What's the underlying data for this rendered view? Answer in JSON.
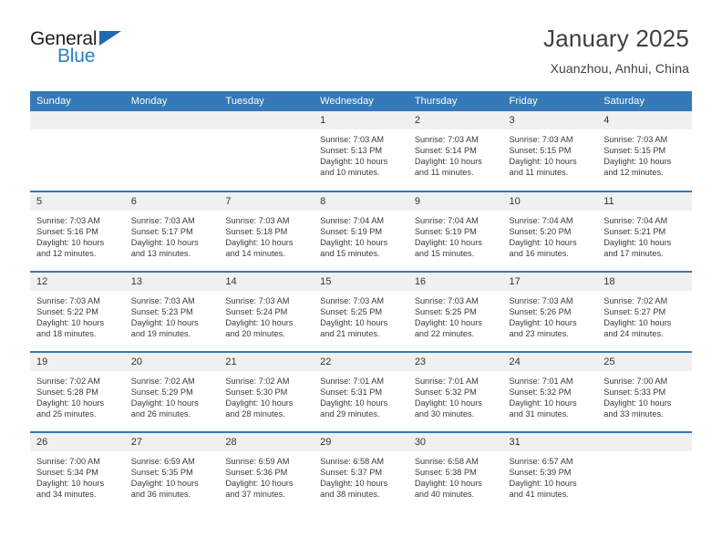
{
  "brand": {
    "name_top": "General",
    "name_bottom": "Blue",
    "triangle_color": "#1f6bb0",
    "blue_color": "#2a7fc1"
  },
  "header": {
    "title": "January 2025",
    "subtitle": "Xuanzhou, Anhui, China"
  },
  "theme": {
    "header_bg": "#3579b8",
    "daynum_bg": "#f0f0f0",
    "text_color": "#3a3a3a"
  },
  "weekdays": [
    "Sunday",
    "Monday",
    "Tuesday",
    "Wednesday",
    "Thursday",
    "Friday",
    "Saturday"
  ],
  "weeks": [
    [
      {
        "day": "",
        "empty": true
      },
      {
        "day": "",
        "empty": true
      },
      {
        "day": "",
        "empty": true
      },
      {
        "day": "1",
        "sunrise": "Sunrise: 7:03 AM",
        "sunset": "Sunset: 5:13 PM",
        "daylight1": "Daylight: 10 hours",
        "daylight2": "and 10 minutes."
      },
      {
        "day": "2",
        "sunrise": "Sunrise: 7:03 AM",
        "sunset": "Sunset: 5:14 PM",
        "daylight1": "Daylight: 10 hours",
        "daylight2": "and 11 minutes."
      },
      {
        "day": "3",
        "sunrise": "Sunrise: 7:03 AM",
        "sunset": "Sunset: 5:15 PM",
        "daylight1": "Daylight: 10 hours",
        "daylight2": "and 11 minutes."
      },
      {
        "day": "4",
        "sunrise": "Sunrise: 7:03 AM",
        "sunset": "Sunset: 5:15 PM",
        "daylight1": "Daylight: 10 hours",
        "daylight2": "and 12 minutes."
      }
    ],
    [
      {
        "day": "5",
        "sunrise": "Sunrise: 7:03 AM",
        "sunset": "Sunset: 5:16 PM",
        "daylight1": "Daylight: 10 hours",
        "daylight2": "and 12 minutes."
      },
      {
        "day": "6",
        "sunrise": "Sunrise: 7:03 AM",
        "sunset": "Sunset: 5:17 PM",
        "daylight1": "Daylight: 10 hours",
        "daylight2": "and 13 minutes."
      },
      {
        "day": "7",
        "sunrise": "Sunrise: 7:03 AM",
        "sunset": "Sunset: 5:18 PM",
        "daylight1": "Daylight: 10 hours",
        "daylight2": "and 14 minutes."
      },
      {
        "day": "8",
        "sunrise": "Sunrise: 7:04 AM",
        "sunset": "Sunset: 5:19 PM",
        "daylight1": "Daylight: 10 hours",
        "daylight2": "and 15 minutes."
      },
      {
        "day": "9",
        "sunrise": "Sunrise: 7:04 AM",
        "sunset": "Sunset: 5:19 PM",
        "daylight1": "Daylight: 10 hours",
        "daylight2": "and 15 minutes."
      },
      {
        "day": "10",
        "sunrise": "Sunrise: 7:04 AM",
        "sunset": "Sunset: 5:20 PM",
        "daylight1": "Daylight: 10 hours",
        "daylight2": "and 16 minutes."
      },
      {
        "day": "11",
        "sunrise": "Sunrise: 7:04 AM",
        "sunset": "Sunset: 5:21 PM",
        "daylight1": "Daylight: 10 hours",
        "daylight2": "and 17 minutes."
      }
    ],
    [
      {
        "day": "12",
        "sunrise": "Sunrise: 7:03 AM",
        "sunset": "Sunset: 5:22 PM",
        "daylight1": "Daylight: 10 hours",
        "daylight2": "and 18 minutes."
      },
      {
        "day": "13",
        "sunrise": "Sunrise: 7:03 AM",
        "sunset": "Sunset: 5:23 PM",
        "daylight1": "Daylight: 10 hours",
        "daylight2": "and 19 minutes."
      },
      {
        "day": "14",
        "sunrise": "Sunrise: 7:03 AM",
        "sunset": "Sunset: 5:24 PM",
        "daylight1": "Daylight: 10 hours",
        "daylight2": "and 20 minutes."
      },
      {
        "day": "15",
        "sunrise": "Sunrise: 7:03 AM",
        "sunset": "Sunset: 5:25 PM",
        "daylight1": "Daylight: 10 hours",
        "daylight2": "and 21 minutes."
      },
      {
        "day": "16",
        "sunrise": "Sunrise: 7:03 AM",
        "sunset": "Sunset: 5:25 PM",
        "daylight1": "Daylight: 10 hours",
        "daylight2": "and 22 minutes."
      },
      {
        "day": "17",
        "sunrise": "Sunrise: 7:03 AM",
        "sunset": "Sunset: 5:26 PM",
        "daylight1": "Daylight: 10 hours",
        "daylight2": "and 23 minutes."
      },
      {
        "day": "18",
        "sunrise": "Sunrise: 7:02 AM",
        "sunset": "Sunset: 5:27 PM",
        "daylight1": "Daylight: 10 hours",
        "daylight2": "and 24 minutes."
      }
    ],
    [
      {
        "day": "19",
        "sunrise": "Sunrise: 7:02 AM",
        "sunset": "Sunset: 5:28 PM",
        "daylight1": "Daylight: 10 hours",
        "daylight2": "and 25 minutes."
      },
      {
        "day": "20",
        "sunrise": "Sunrise: 7:02 AM",
        "sunset": "Sunset: 5:29 PM",
        "daylight1": "Daylight: 10 hours",
        "daylight2": "and 26 minutes."
      },
      {
        "day": "21",
        "sunrise": "Sunrise: 7:02 AM",
        "sunset": "Sunset: 5:30 PM",
        "daylight1": "Daylight: 10 hours",
        "daylight2": "and 28 minutes."
      },
      {
        "day": "22",
        "sunrise": "Sunrise: 7:01 AM",
        "sunset": "Sunset: 5:31 PM",
        "daylight1": "Daylight: 10 hours",
        "daylight2": "and 29 minutes."
      },
      {
        "day": "23",
        "sunrise": "Sunrise: 7:01 AM",
        "sunset": "Sunset: 5:32 PM",
        "daylight1": "Daylight: 10 hours",
        "daylight2": "and 30 minutes."
      },
      {
        "day": "24",
        "sunrise": "Sunrise: 7:01 AM",
        "sunset": "Sunset: 5:32 PM",
        "daylight1": "Daylight: 10 hours",
        "daylight2": "and 31 minutes."
      },
      {
        "day": "25",
        "sunrise": "Sunrise: 7:00 AM",
        "sunset": "Sunset: 5:33 PM",
        "daylight1": "Daylight: 10 hours",
        "daylight2": "and 33 minutes."
      }
    ],
    [
      {
        "day": "26",
        "sunrise": "Sunrise: 7:00 AM",
        "sunset": "Sunset: 5:34 PM",
        "daylight1": "Daylight: 10 hours",
        "daylight2": "and 34 minutes."
      },
      {
        "day": "27",
        "sunrise": "Sunrise: 6:59 AM",
        "sunset": "Sunset: 5:35 PM",
        "daylight1": "Daylight: 10 hours",
        "daylight2": "and 36 minutes."
      },
      {
        "day": "28",
        "sunrise": "Sunrise: 6:59 AM",
        "sunset": "Sunset: 5:36 PM",
        "daylight1": "Daylight: 10 hours",
        "daylight2": "and 37 minutes."
      },
      {
        "day": "29",
        "sunrise": "Sunrise: 6:58 AM",
        "sunset": "Sunset: 5:37 PM",
        "daylight1": "Daylight: 10 hours",
        "daylight2": "and 38 minutes."
      },
      {
        "day": "30",
        "sunrise": "Sunrise: 6:58 AM",
        "sunset": "Sunset: 5:38 PM",
        "daylight1": "Daylight: 10 hours",
        "daylight2": "and 40 minutes."
      },
      {
        "day": "31",
        "sunrise": "Sunrise: 6:57 AM",
        "sunset": "Sunset: 5:39 PM",
        "daylight1": "Daylight: 10 hours",
        "daylight2": "and 41 minutes."
      },
      {
        "day": "",
        "empty": true
      }
    ]
  ]
}
